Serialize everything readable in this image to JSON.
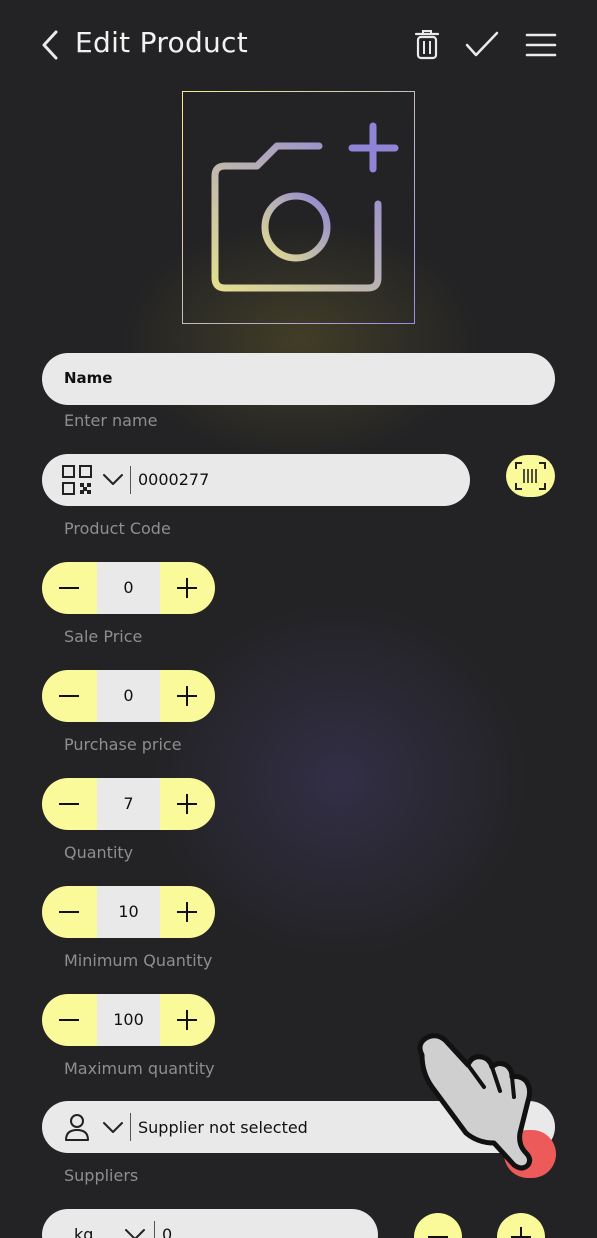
{
  "header": {
    "title": "Edit Product"
  },
  "form": {
    "name_label": "Name",
    "name_helper": "Enter name",
    "code_value": "0000277",
    "code_helper": "Product Code",
    "sale_price": "0",
    "sale_price_helper": "Sale Price",
    "purchase_price": "0",
    "purchase_price_helper": "Purchase price",
    "quantity": "7",
    "quantity_helper": "Quantity",
    "min_quantity": "10",
    "min_quantity_helper": "Minimum Quantity",
    "max_quantity": "100",
    "max_quantity_helper": "Maximum quantity",
    "supplier_value": "Supplier not selected",
    "supplier_helper": "Suppliers",
    "unit": "kg",
    "unit_value": "0"
  },
  "colors": {
    "background": "#232325",
    "accent_yellow": "#fafa9a",
    "field_bg": "#e9e9e9",
    "fab_red": "#ec5a5a"
  },
  "icons": [
    "back-icon",
    "trash-icon",
    "check-icon",
    "menu-icon",
    "add-photo-icon",
    "qr-code-icon",
    "barcode-scan-icon",
    "person-icon",
    "chevron-down-icon",
    "pointing-hand-icon"
  ]
}
